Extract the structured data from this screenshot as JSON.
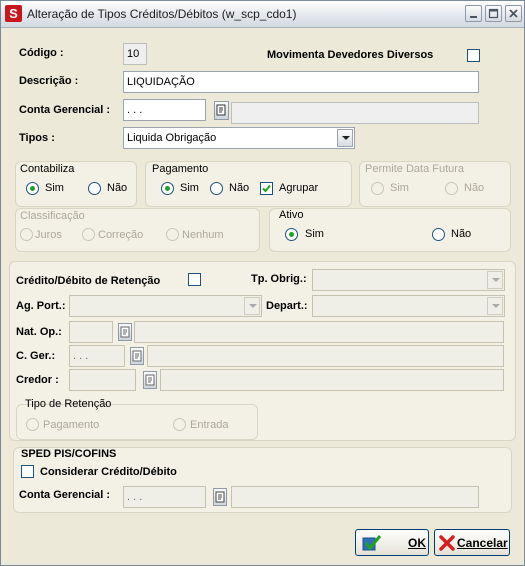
{
  "window": {
    "title": "Alteração de Tipos Créditos/Débitos (w_scp_cdo1)",
    "app_icon": "S"
  },
  "form": {
    "codigo_label": "Código :",
    "codigo_value": "10",
    "movimenta_label": "Movimenta Devedores Diversos",
    "descricao_label": "Descrição :",
    "descricao_value": "LIQUIDAÇÃO",
    "conta_label": "Conta Gerencial :",
    "conta_value": ". . .",
    "tipos_label": "Tipos :",
    "tipos_value": "Liquida Obrigação"
  },
  "contabiliza": {
    "title": "Contabiliza",
    "sim": "Sim",
    "nao": "Não",
    "selected": "Sim"
  },
  "pagamento": {
    "title": "Pagamento",
    "sim": "Sim",
    "nao": "Não",
    "agrupar": "Agrupar",
    "selected": "Sim",
    "agrupar_checked": true
  },
  "permite": {
    "title": "Permite Data Futura",
    "sim": "Sim",
    "nao": "Não"
  },
  "classificacao": {
    "title": "Classificação",
    "juros": "Juros",
    "correcao": "Correção",
    "nenhum": "Nenhum"
  },
  "ativo": {
    "title": "Ativo",
    "sim": "Sim",
    "nao": "Não",
    "selected": "Sim"
  },
  "retencao": {
    "credito_label": "Crédito/Débito de Retenção",
    "tp_obrig_label": "Tp. Obrig.:",
    "ag_port_label": "Ag. Port.:",
    "depart_label": "Depart.:",
    "nat_op_label": "Nat. Op.:",
    "c_ger_label": "C. Ger.:",
    "c_ger_value": ". . .",
    "credor_label": "Credor :"
  },
  "tipo_retencao": {
    "title": "Tipo de Retenção",
    "pagamento": "Pagamento",
    "entrada": "Entrada"
  },
  "sped": {
    "title": "SPED PIS/COFINS",
    "considerar_label": "Considerar Crédito/Débito",
    "conta_label": "Conta Gerencial :",
    "conta_value": ". . ."
  },
  "buttons": {
    "ok": "OK",
    "cancelar": "Cancelar"
  },
  "icons": {
    "app": "app-logo-icon",
    "minimize": "minimize-icon",
    "maximize": "maximize-icon",
    "close": "close-icon",
    "lookup": "lookup-icon",
    "dropdown": "chevron-down-icon",
    "ok": "checkmark-icon",
    "cancel": "cancel-x-icon"
  },
  "colors": {
    "accent_green": "#21a121",
    "cancel_red": "#d42020",
    "window_bg": "#ece9d8"
  }
}
